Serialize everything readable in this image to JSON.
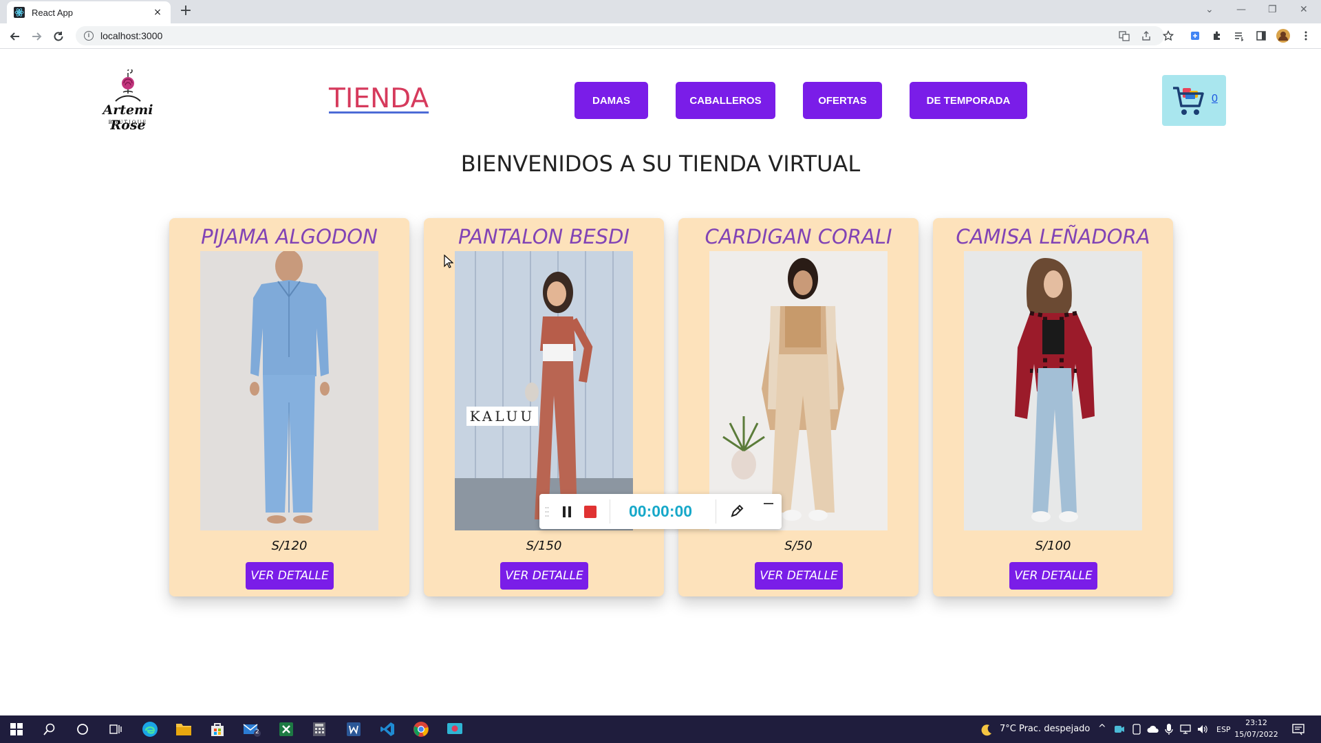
{
  "browser": {
    "tab_title": "React App",
    "tab_close": "×",
    "new_tab": "+",
    "url": "localhost:3000",
    "info": "i"
  },
  "site": {
    "logo_text": "Artemi Rose",
    "logo_sub": "BOUTIQUE",
    "brand": "TIENDA",
    "nav": [
      "DAMAS",
      "CABALLEROS",
      "OFERTAS",
      "DE TEMPORADA"
    ],
    "cart_count": "0",
    "welcome": "BIENVENIDOS A SU TIENDA VIRTUAL"
  },
  "products": [
    {
      "title": "PIJAMA ALGODON",
      "price": "S/120",
      "button": "VER DETALLE"
    },
    {
      "title": "PANTALON BESDI",
      "price": "S/150",
      "button": "VER DETALLE",
      "photo_label": "KALUU"
    },
    {
      "title": "CARDIGAN CORALI",
      "price": "S/50",
      "button": "VER DETALLE"
    },
    {
      "title": "CAMISA LEÑADORA",
      "price": "S/100",
      "button": "VER DETALLE"
    }
  ],
  "recorder": {
    "time": "00:00:00"
  },
  "taskbar": {
    "weather": "7°C  Prac. despejado",
    "lang": "ESP",
    "time": "23:12",
    "date": "15/07/2022",
    "mail_badge": "2"
  },
  "colors": {
    "accent": "#7a1de8",
    "card_bg": "#fde2bb",
    "title": "#8143b5",
    "brand": "#d63a5c",
    "cart_bg": "#a9e6ee"
  }
}
